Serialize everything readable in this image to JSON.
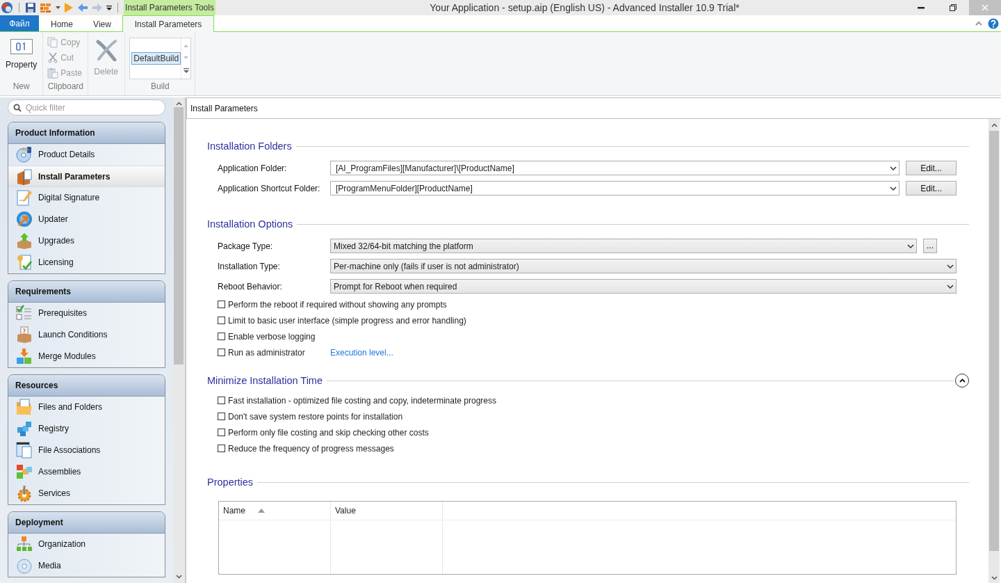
{
  "title_bar": {
    "contextual_tab": "Install Parameters Tools",
    "title": "Your Application - setup.aip (English US) - Advanced Installer 10.9 Trial*"
  },
  "ribbon_tabs": [
    {
      "label": "Файл",
      "kind": "file",
      "selected": false
    },
    {
      "label": "Home",
      "kind": "tab",
      "selected": false
    },
    {
      "label": "View",
      "kind": "tab",
      "selected": false
    },
    {
      "label": "Install Parameters",
      "kind": "contextual",
      "selected": true
    }
  ],
  "ribbon_groups": [
    {
      "label": "New",
      "controls": [
        {
          "kind": "large",
          "label": "Property",
          "disabled": false
        }
      ]
    },
    {
      "label": "Clipboard",
      "controls": [
        {
          "kind": "small",
          "label": "Copy",
          "disabled": true
        },
        {
          "kind": "small",
          "label": "Cut",
          "disabled": true
        },
        {
          "kind": "small",
          "label": "Paste",
          "disabled": true
        }
      ]
    },
    {
      "controls": [
        {
          "kind": "large",
          "label": "Delete",
          "disabled": true
        }
      ]
    },
    {
      "label": "Build",
      "controls": [
        {
          "kind": "list",
          "items": [
            {
              "label": "DefaultBuild",
              "selected": true
            }
          ]
        }
      ]
    }
  ],
  "sidebar": {
    "filter_placeholder": "Quick filter",
    "groups": [
      {
        "title": "Product Information",
        "items": [
          {
            "label": "Product Details",
            "selected": false
          },
          {
            "label": "Install Parameters",
            "selected": true
          },
          {
            "label": "Digital Signature",
            "selected": false
          },
          {
            "label": "Updater",
            "selected": false
          },
          {
            "label": "Upgrades",
            "selected": false
          },
          {
            "label": "Licensing",
            "selected": false
          }
        ]
      },
      {
        "title": "Requirements",
        "items": [
          {
            "label": "Prerequisites",
            "selected": false
          },
          {
            "label": "Launch Conditions",
            "selected": false
          },
          {
            "label": "Merge Modules",
            "selected": false
          }
        ]
      },
      {
        "title": "Resources",
        "items": [
          {
            "label": "Files and Folders",
            "selected": false
          },
          {
            "label": "Registry",
            "selected": false
          },
          {
            "label": "File Associations",
            "selected": false
          },
          {
            "label": "Assemblies",
            "selected": false
          },
          {
            "label": "Services",
            "selected": false
          }
        ]
      },
      {
        "title": "Deployment",
        "items": [
          {
            "label": "Organization",
            "selected": false
          },
          {
            "label": "Media",
            "selected": false
          }
        ]
      }
    ]
  },
  "content": {
    "title": "Install Parameters",
    "sections": [
      {
        "kind": "form",
        "title": "Installation Folders",
        "rows": [
          {
            "kind": "path",
            "label": "Application Folder:",
            "value": "[AI_ProgramFiles][Manufacturer]\\[ProductName]",
            "button": "Edit..."
          },
          {
            "kind": "path",
            "label": "Application Shortcut Folder:",
            "value": "[ProgramMenuFolder][ProductName]",
            "button": "Edit..."
          }
        ]
      },
      {
        "kind": "form",
        "title": "Installation Options",
        "rows": [
          {
            "kind": "combo",
            "label": "Package Type:",
            "value": "Mixed 32/64-bit matching the platform",
            "button": "..."
          },
          {
            "kind": "combo",
            "label": "Installation Type:",
            "value": "Per-machine only (fails if user is not administrator)"
          },
          {
            "kind": "combo",
            "label": "Reboot Behavior:",
            "value": "Prompt for Reboot when required"
          },
          {
            "kind": "checkbox",
            "label": "Perform the reboot if required without showing any prompts",
            "checked": false
          },
          {
            "kind": "checkbox",
            "label": "Limit to basic user interface (simple progress and error handling)",
            "checked": false
          },
          {
            "kind": "checkbox",
            "label": "Enable verbose logging",
            "checked": false
          },
          {
            "kind": "checkbox",
            "label": "Run as administrator",
            "checked": false,
            "link": "Execution level..."
          }
        ]
      },
      {
        "kind": "collapsible",
        "title": "Minimize Installation Time",
        "expanded": true,
        "rows": [
          {
            "kind": "checkbox",
            "label": "Fast installation - optimized file costing and copy, indeterminate progress",
            "checked": false
          },
          {
            "kind": "checkbox",
            "label": "Don't save system restore points for installation",
            "checked": false
          },
          {
            "kind": "checkbox",
            "label": "Perform only file costing and skip checking other costs",
            "checked": false
          },
          {
            "kind": "checkbox",
            "label": "Reduce the frequency of progress messages",
            "checked": false
          }
        ]
      },
      {
        "kind": "table",
        "title": "Properties",
        "columns": [
          {
            "label": "Name",
            "sorted": true
          },
          {
            "label": "Value",
            "sorted": false
          }
        ]
      }
    ]
  }
}
